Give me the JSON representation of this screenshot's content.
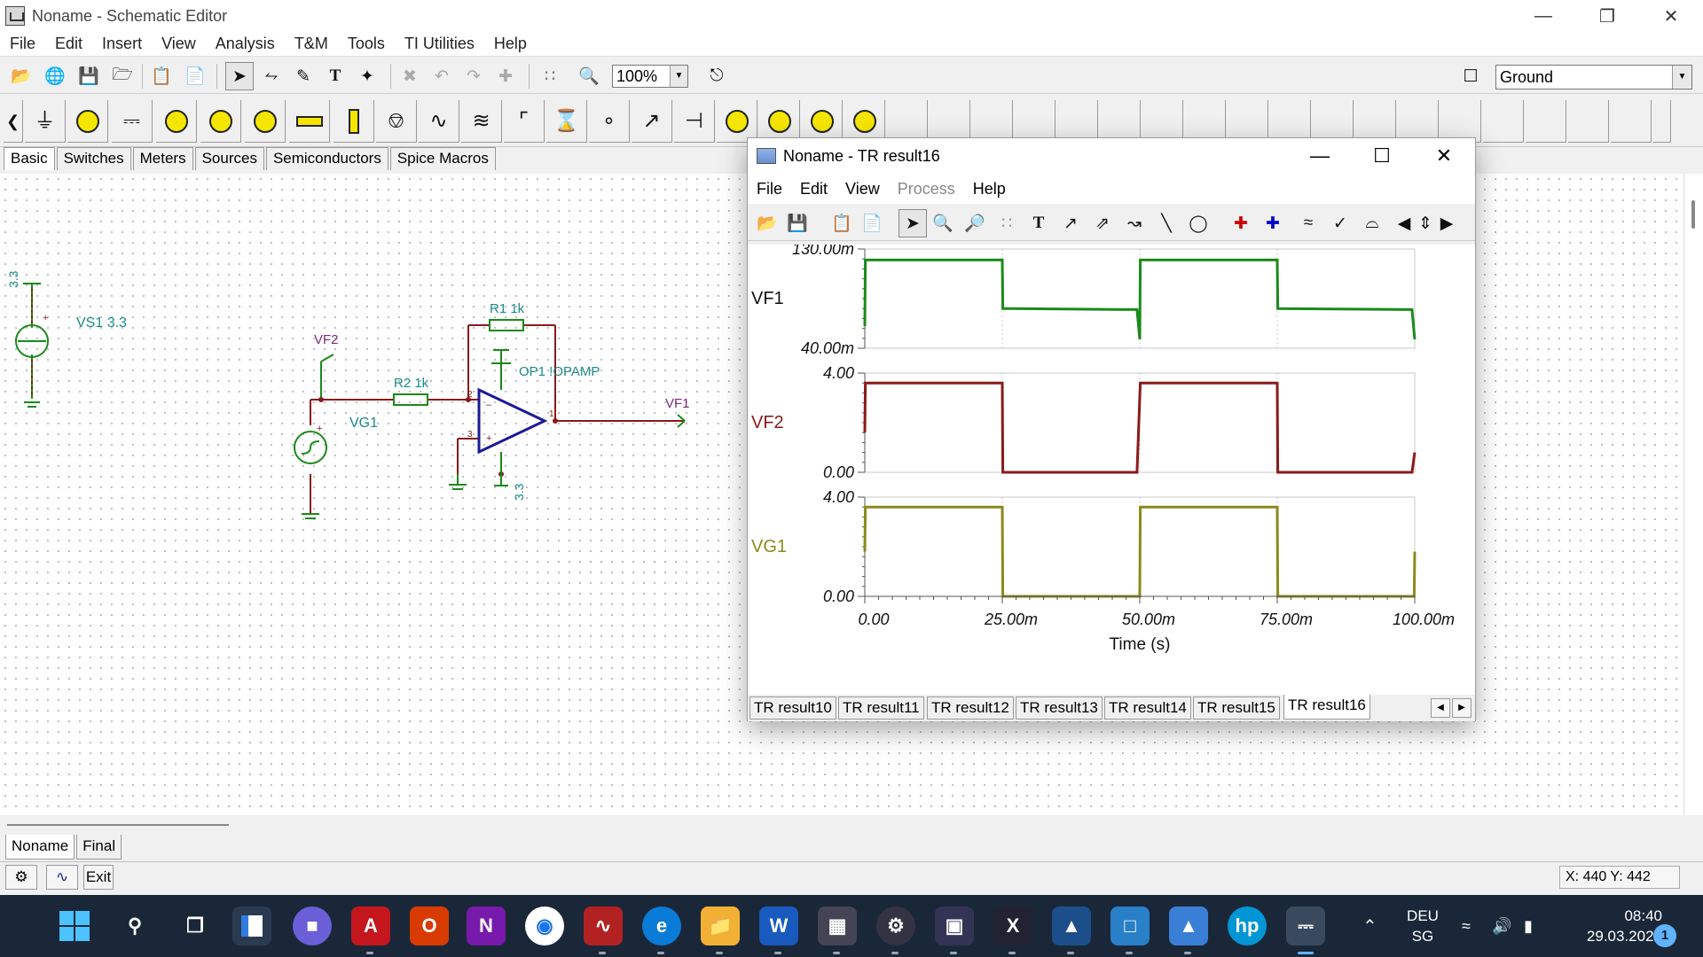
{
  "window": {
    "title": "Noname - Schematic Editor"
  },
  "menu": [
    "File",
    "Edit",
    "Insert",
    "View",
    "Analysis",
    "T&M",
    "Tools",
    "TI Utilities",
    "Help"
  ],
  "toolbar": {
    "zoom": "100%",
    "component_select": "Ground"
  },
  "component_tabs": [
    "Basic",
    "Switches",
    "Meters",
    "Sources",
    "Semiconductors",
    "Spice Macros"
  ],
  "schematic": {
    "labels": {
      "vs1_value": "3.3",
      "vs1": "VS1 3.3",
      "vf2": "VF2",
      "r1": "R1 1k",
      "r2": "R2 1k",
      "op1": "OP1 !OPAMP",
      "vg1": "VG1",
      "vf1": "VF1",
      "pin2": "2",
      "pin3": "3",
      "pin1": "1",
      "supply": "3.3"
    }
  },
  "sheet_tabs": [
    "Noname",
    "Final"
  ],
  "status": {
    "exit_label": "Exit",
    "coords": "X: 440  Y: 442"
  },
  "result_window": {
    "title": "Noname - TR result16",
    "menu": [
      {
        "label": "File",
        "enabled": true
      },
      {
        "label": "Edit",
        "enabled": true
      },
      {
        "label": "View",
        "enabled": true
      },
      {
        "label": "Process",
        "enabled": false
      },
      {
        "label": "Help",
        "enabled": true
      }
    ],
    "tabs": [
      "TR result10",
      "TR result11",
      "TR result12",
      "TR result13",
      "TR result14",
      "TR result15",
      "TR result16"
    ],
    "active_tab": "TR result16"
  },
  "chart_data": {
    "type": "line",
    "xlabel": "Time (s)",
    "x_ticks": [
      "0.00",
      "25.00m",
      "50.00m",
      "75.00m",
      "100.00m"
    ],
    "xlim": [
      0,
      0.1
    ],
    "panels": [
      {
        "name": "VF1",
        "color": "#1a8a1a",
        "y_ticks": [
          "130.00m",
          "40.00m"
        ],
        "ylim": [
          0.04,
          0.13
        ],
        "x": [
          0,
          0.0001,
          0.025,
          0.0251,
          0.0495,
          0.05,
          0.0501,
          0.075,
          0.0751,
          0.0995,
          0.1
        ],
        "y": [
          0.06,
          0.12,
          0.12,
          0.076,
          0.075,
          0.048,
          0.12,
          0.12,
          0.076,
          0.075,
          0.048
        ]
      },
      {
        "name": "VF2",
        "color": "#8a1a1a",
        "y_ticks": [
          "4.00",
          "0.00"
        ],
        "ylim": [
          0,
          4
        ],
        "x": [
          0,
          0.0001,
          0.025,
          0.0251,
          0.0495,
          0.0501,
          0.075,
          0.0751,
          0.0995,
          0.1
        ],
        "y": [
          1.6,
          3.6,
          3.6,
          0,
          0,
          3.6,
          3.6,
          0,
          0,
          0.8
        ]
      },
      {
        "name": "VG1",
        "color": "#8a8a1a",
        "y_ticks": [
          "4.00",
          "0.00"
        ],
        "ylim": [
          0,
          4
        ],
        "x": [
          0,
          0.0001,
          0.025,
          0.0251,
          0.05,
          0.0501,
          0.075,
          0.0751,
          0.0999,
          0.1
        ],
        "y": [
          1.8,
          3.6,
          3.6,
          0,
          0,
          3.6,
          3.6,
          0,
          0,
          1.8
        ]
      }
    ]
  },
  "taskbar": {
    "lang": "DEU",
    "region": "SG",
    "time": "08:40",
    "date": "29.03.2022",
    "notifications": "1"
  }
}
